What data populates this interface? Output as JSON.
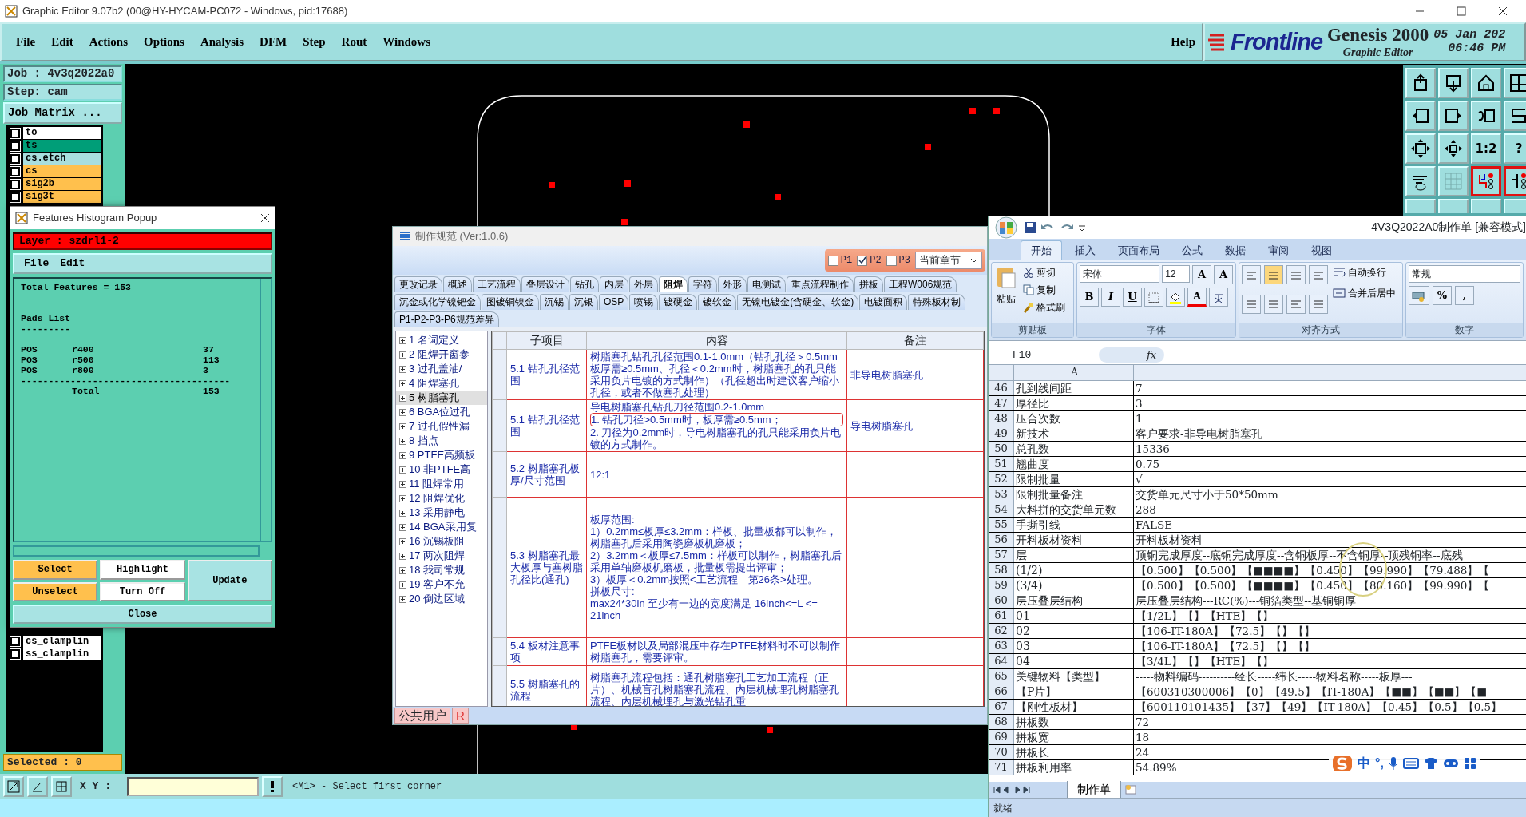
{
  "window": {
    "title": "Graphic Editor 9.07b2 (00@HY-HYCAM-PC072 - Windows, pid:17688)"
  },
  "menu": [
    "File",
    "Edit",
    "Actions",
    "Options",
    "Analysis",
    "DFM",
    "Step",
    "Rout",
    "Windows"
  ],
  "help": "Help",
  "brand": {
    "logo": "Frontline",
    "product": "Genesis 2000",
    "subtitle": "Graphic Editor",
    "date": "05 Jan 202",
    "time": "06:46 PM"
  },
  "job": {
    "job": "Job : 4v3q2022a0",
    "step": "Step: cam",
    "matrix_button": "Job Matrix ..."
  },
  "layers": [
    {
      "name": "to",
      "color": "#ffffff",
      "checked": false
    },
    {
      "name": "ts",
      "color": "#009e78",
      "checked": false
    },
    {
      "name": "cs.etch",
      "color": "#a8dede",
      "checked": false
    },
    {
      "name": "cs",
      "color": "#ffc04d",
      "checked": false
    },
    {
      "name": "sig2b",
      "color": "#ffc04d",
      "checked": false
    },
    {
      "name": "sig3t",
      "color": "#ffc04d",
      "checked": false
    }
  ],
  "lower_layers": [
    {
      "name": "cs_clamplin",
      "color": "#ffffff",
      "checked": false
    },
    {
      "name": "ss_clamplin",
      "color": "#ffffff",
      "checked": false
    }
  ],
  "selected_count": "Selected : 0",
  "toolbar": [
    {
      "on": false
    },
    {
      "on": false
    },
    {
      "on": false
    },
    {
      "on": false
    },
    {
      "on": false
    },
    {
      "on": false
    },
    {
      "on": false
    },
    {
      "on": false
    },
    {
      "on": false
    },
    {
      "on": false
    },
    {
      "label": "1:2",
      "on": false
    },
    {
      "label": "?",
      "on": false
    },
    {
      "on": false
    },
    {
      "on": false
    },
    {
      "on": true
    },
    {
      "on": true
    },
    {
      "on": false
    },
    {
      "on": false
    },
    {
      "on": false
    },
    {
      "on": false
    }
  ],
  "coordinates": {
    "label": "X Y :",
    "message": "<M1> - Select first corner"
  },
  "histogram": {
    "title": "Features Histogram Popup",
    "layer": "Layer :  szdrl1-2",
    "menu": [
      "File",
      "Edit"
    ],
    "summary": "Total Features = 153",
    "section": "Pads List",
    "rule": "---------",
    "rows": [
      {
        "type": "POS",
        "symbol": "r400",
        "count": "37"
      },
      {
        "type": "POS",
        "symbol": "r500",
        "count": "113"
      },
      {
        "type": "POS",
        "symbol": "r800",
        "count": "3"
      }
    ],
    "divider": "--------------------------------------",
    "total_label": "Total",
    "total": "153",
    "buttons": [
      {
        "label": "Select",
        "kind": "orange"
      },
      {
        "label": "Highlight",
        "kind": "white"
      },
      {
        "label": "Update",
        "kind": "tall"
      },
      {
        "label": "Unselect",
        "kind": "orange"
      },
      {
        "label": "Turn Off",
        "kind": "white"
      }
    ],
    "close": "Close"
  },
  "spec_dialog": {
    "title": "制作规范 (Ver:1.0.6)",
    "filters": [
      {
        "label": "P1",
        "checked": false
      },
      {
        "label": "P2",
        "checked": true
      },
      {
        "label": "P3",
        "checked": false
      }
    ],
    "scope": "当前章节",
    "tab_rows": [
      [
        {
          "label": "更改记录",
          "selected": false
        },
        {
          "label": "概述",
          "selected": false
        },
        {
          "label": "工艺流程",
          "selected": false
        },
        {
          "label": "叠层设计",
          "selected": false
        },
        {
          "label": "钻孔",
          "selected": false
        },
        {
          "label": "内层",
          "selected": false
        },
        {
          "label": "外层",
          "selected": false
        },
        {
          "label": "阻焊",
          "selected": true
        },
        {
          "label": "字符",
          "selected": false
        },
        {
          "label": "外形",
          "selected": false
        },
        {
          "label": "电测试",
          "selected": false
        },
        {
          "label": "重点流程制作",
          "selected": false
        },
        {
          "label": "拼板",
          "selected": false
        },
        {
          "label": "工程W006规范",
          "selected": false
        }
      ],
      [
        {
          "label": "沉金或化学镍钯金",
          "selected": false
        },
        {
          "label": "图镀铜镍金",
          "selected": false
        },
        {
          "label": "沉锡",
          "selected": false
        },
        {
          "label": "沉银",
          "selected": false
        },
        {
          "label": "OSP",
          "selected": false
        },
        {
          "label": "喷锡",
          "selected": false
        },
        {
          "label": "镀硬金",
          "selected": false
        },
        {
          "label": "镀软金",
          "selected": false
        },
        {
          "label": "无镍电镀金(含硬金、软金)",
          "selected": false
        },
        {
          "label": "电镀面积",
          "selected": false
        },
        {
          "label": "特殊板材制",
          "selected": false
        }
      ],
      [
        {
          "label": "P1-P2-P3-P6规范差异",
          "selected": false
        }
      ]
    ],
    "tree": [
      {
        "label": "1 名词定义",
        "selected": false
      },
      {
        "label": "2 阻焊开窗参",
        "selected": false
      },
      {
        "label": "3 过孔盖油/",
        "selected": false
      },
      {
        "label": "4 阻焊塞孔",
        "selected": false
      },
      {
        "label": "5 树脂塞孔",
        "selected": true
      },
      {
        "label": "6 BGA位过孔",
        "selected": false
      },
      {
        "label": "7 过孔假性漏",
        "selected": false
      },
      {
        "label": "8 挡点",
        "selected": false
      },
      {
        "label": "9 PTFE高频板",
        "selected": false
      },
      {
        "label": "10 非PTFE高",
        "selected": false
      },
      {
        "label": "11 阻焊常用",
        "selected": false
      },
      {
        "label": "12 阻焊优化",
        "selected": false
      },
      {
        "label": "13 采用静电",
        "selected": false
      },
      {
        "label": "14 BGA采用复",
        "selected": false
      },
      {
        "label": "16 沉锡板阻",
        "selected": false
      },
      {
        "label": "17 两次阻焊",
        "selected": false
      },
      {
        "label": "18 我司常规",
        "selected": false
      },
      {
        "label": "19 客户不允",
        "selected": false
      },
      {
        "label": "20 倒边区域",
        "selected": false
      }
    ],
    "columns": [
      "子项目",
      "内容",
      "备注"
    ],
    "rows": [
      {
        "item": "5.1 钻孔孔径范围",
        "content": [
          {
            "text": "树脂塞孔钻孔孔径范围0.1-1.0mm（钻孔孔径＞0.5mm板厚需≥0.5mm、孔径＜0.2mm时，树脂塞孔的孔只能采用负片电镀的方式制作）（孔径超出时建议客户缩小孔径，或者不做塞孔处理）",
            "boxed": false
          }
        ],
        "note": "非导电树脂塞孔"
      },
      {
        "item": "5.1 钻孔孔径范围",
        "content": [
          {
            "text": "导电树脂塞孔钻孔刀径范围0.2-1.0mm",
            "boxed": false
          },
          {
            "text": "1. 钻孔刀径>0.5mm时，板厚需≥0.5mm；",
            "boxed": true
          },
          {
            "text": "2. 刀径为0.2mm时，导电树脂塞孔的孔只能采用负片电镀的方式制作。",
            "boxed": false
          }
        ],
        "note": "导电树脂塞孔"
      },
      {
        "item": "5.2 树脂塞孔板厚/尺寸范围",
        "content": [
          {
            "text": "12:1",
            "boxed": false
          }
        ]
      },
      {
        "item": "5.3 树脂塞孔最大板厚与塞树脂孔径比(通孔)",
        "content": [
          {
            "text": "板厚范围:",
            "boxed": false
          },
          {
            "text": "1）0.2mm≤板厚≤3.2mm：样板、批量板都可以制作，树脂塞孔后采用陶瓷磨板机磨板；",
            "boxed": false
          },
          {
            "text": "2）3.2mm＜板厚≤7.5mm：样板可以制作，树脂塞孔后采用单轴磨板机磨板，批量板需提出评审；",
            "boxed": false
          },
          {
            "text": "3）板厚＜0.2mm按照<工艺流程　第26条>处理。",
            "boxed": false
          },
          {
            "text": "拼板尺寸:",
            "boxed": false
          },
          {
            "text": "max24*30in 至少有一边的宽度满足 16inch<=L <= 21inch",
            "boxed": false
          }
        ]
      },
      {
        "item": "5.4 板材注意事项",
        "content": [
          {
            "text": "PTFE板材以及局部混压中存在PTFE材料时不可以制作树脂塞孔，需要评审。",
            "boxed": false
          }
        ]
      },
      {
        "item": "5.5 树脂塞孔的流程",
        "content": [
          {
            "text": "树脂塞孔流程包括：通孔树脂塞孔工艺加工流程（正片）、机械盲孔树脂塞孔流程、内层机械埋孔树脂塞孔流程、内层机械埋孔与激光钻孔重",
            "boxed": false
          }
        ]
      }
    ],
    "status": [
      "公共用户",
      "R"
    ]
  },
  "excel": {
    "title": "4V3Q2022A0制作单 [兼容模式]",
    "tabs": [
      {
        "label": "开始",
        "selected": true
      },
      {
        "label": "插入",
        "selected": false
      },
      {
        "label": "页面布局",
        "selected": false
      },
      {
        "label": "公式",
        "selected": false
      },
      {
        "label": "数据",
        "selected": false
      },
      {
        "label": "审阅",
        "selected": false
      },
      {
        "label": "视图",
        "selected": false
      }
    ],
    "clipboard": {
      "paste": "粘贴",
      "cut": "剪切",
      "copy": "复制",
      "format_painter": "格式刷",
      "group": "剪贴板"
    },
    "font": {
      "name": "宋体",
      "size": "12",
      "grow": "A",
      "shrink": "A",
      "bold": "B",
      "italic": "I",
      "underline": "U",
      "font_color_label": "A",
      "group": "字体"
    },
    "alignment": {
      "wrap": "自动换行",
      "merge": "合并后居中",
      "group": "对齐方式"
    },
    "number": {
      "format": "常规",
      "percent": "%",
      "comma": ",",
      "group": "数字"
    },
    "name_box": "F10",
    "fx": "fx",
    "column": "A",
    "rows": [
      {
        "n": "46",
        "a": "孔到线间距",
        "b": "7"
      },
      {
        "n": "47",
        "a": "厚径比",
        "b": "3"
      },
      {
        "n": "48",
        "a": "压合次数",
        "b": "1"
      },
      {
        "n": "49",
        "a": "新技术",
        "b": "客户要求-非导电树脂塞孔"
      },
      {
        "n": "50",
        "a": "总孔数",
        "b": "15336"
      },
      {
        "n": "51",
        "a": "翘曲度",
        "b": "0.75"
      },
      {
        "n": "52",
        "a": "限制批量",
        "b": "√"
      },
      {
        "n": "53",
        "a": "限制批量备注",
        "b": "交货单元尺寸小于50*50mm"
      },
      {
        "n": "54",
        "a": "大料拼的交货单元数",
        "b": "288"
      },
      {
        "n": "55",
        "a": "手撕引线",
        "b": "FALSE"
      },
      {
        "n": "56",
        "a": "开料板材资料",
        "b": "开料板材资料"
      },
      {
        "n": "57",
        "a": "层",
        "b": "顶铜完成厚度--底铜完成厚度--含铜板厚--不含铜厚--顶残铜率--底残"
      },
      {
        "n": "58",
        "a": "(1/2)",
        "b": "【0.500】【0.500】【■■■■】【0.450】【99.990】【79.488】【"
      },
      {
        "n": "59",
        "a": "(3/4)",
        "b": "【0.500】【0.500】【■■■■】【0.450】【80.160】【99.990】【"
      },
      {
        "n": "60",
        "a": "层压叠层结构",
        "b": "层压叠层结构---RC(%)---铜箔类型--基铜铜厚"
      },
      {
        "n": "61",
        "a": "01",
        "b": "【1/2L】【】【HTE】【】"
      },
      {
        "n": "62",
        "a": "02",
        "b": "【106-IT-180A】【72.5】【】【】"
      },
      {
        "n": "63",
        "a": "03",
        "b": "【106-IT-180A】【72.5】【】【】"
      },
      {
        "n": "64",
        "a": "04",
        "b": "【3/4L】【】【HTE】【】"
      },
      {
        "n": "65",
        "a": "关键物料【类型】",
        "b": "-----物料编码----------经长-----纬长-----物料名称-----板厚---"
      },
      {
        "n": "66",
        "a": "【P片】",
        "b": "【600310300006】【0】【49.5】【IT-180A】【■■】【■■】【■"
      },
      {
        "n": "67",
        "a": "【刚性板材】",
        "b": "【600110101435】【37】【49】【IT-180A】【0.45】【0.5】【0.5】"
      },
      {
        "n": "68",
        "a": "拼板数",
        "b": "72"
      },
      {
        "n": "69",
        "a": "拼板宽",
        "b": "18"
      },
      {
        "n": "70",
        "a": "拼板长",
        "b": "24"
      },
      {
        "n": "71",
        "a": "拼板利用率",
        "b": "54.89%"
      }
    ],
    "sheets": [
      {
        "label": "制作单",
        "selected": true
      }
    ],
    "status": "就绪"
  },
  "ime": {
    "mode": "中",
    "punctuation": "°,"
  }
}
